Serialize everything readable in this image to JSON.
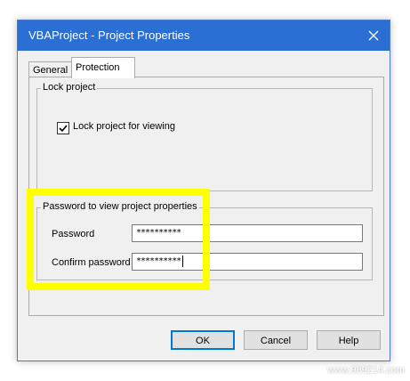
{
  "window": {
    "title": "VBAProject - Project Properties"
  },
  "tabs": [
    {
      "label": "General"
    },
    {
      "label": "Protection"
    }
  ],
  "lock_group": {
    "legend": "Lock project",
    "checkbox_label": "Lock project for viewing",
    "checked": true
  },
  "password_group": {
    "legend": "Password to view project properties",
    "password_label": "Password",
    "password_value": "**********",
    "confirm_label": "Confirm password",
    "confirm_value": "**********"
  },
  "buttons": {
    "ok": "OK",
    "cancel": "Cancel",
    "help": "Help"
  },
  "watermark": "www.989214.com",
  "colors": {
    "highlight": "#ffff00",
    "titlebar": "#2b6fd4"
  }
}
